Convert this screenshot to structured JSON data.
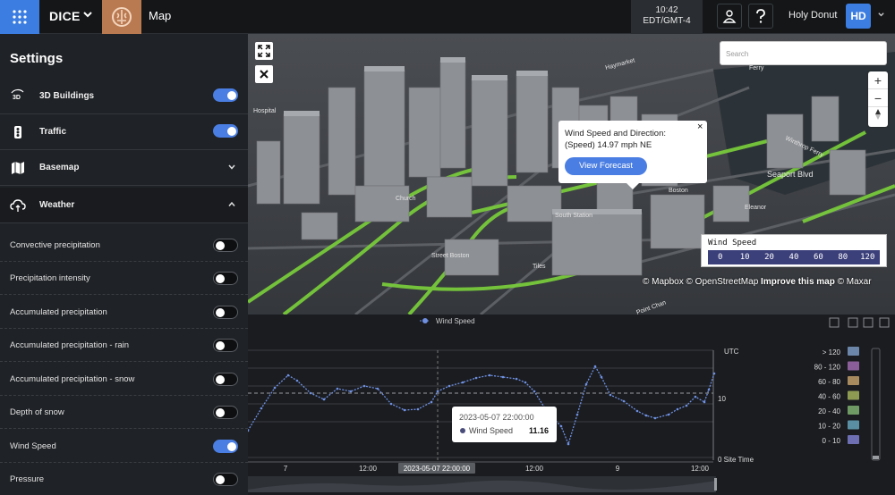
{
  "header": {
    "app_name": "DICE",
    "page_title": "Map",
    "time": "10:42",
    "timezone": "EDT/GMT-4",
    "user_name": "Holy Donut",
    "user_initials": "HD"
  },
  "sidebar": {
    "title": "Settings",
    "sections": [
      {
        "label": "3D Buildings",
        "on": true
      },
      {
        "label": "Traffic",
        "on": true
      },
      {
        "label": "Basemap"
      },
      {
        "label": "Weather"
      }
    ],
    "weather_layers": [
      {
        "label": "Convective precipitation",
        "on": false
      },
      {
        "label": "Precipitation intensity",
        "on": false
      },
      {
        "label": "Accumulated precipitation",
        "on": false
      },
      {
        "label": "Accumulated precipitation - rain",
        "on": false
      },
      {
        "label": "Accumulated precipitation - snow",
        "on": false
      },
      {
        "label": "Depth of snow",
        "on": false
      },
      {
        "label": "Wind Speed",
        "on": true
      },
      {
        "label": "Pressure",
        "on": false
      }
    ]
  },
  "map": {
    "search_placeholder": "Search",
    "popup": {
      "line1": "Wind Speed and Direction:",
      "line2": "(Speed) 14.97 mph NE",
      "button": "View Forecast",
      "close": "×"
    },
    "legend": {
      "title": "Wind Speed",
      "values": [
        "0",
        "10",
        "20",
        "40",
        "60",
        "80",
        "120"
      ]
    },
    "attribution": {
      "mapbox": "© Mapbox",
      "osm": "© OpenStreetMap",
      "improve": "Improve this map",
      "maxar": "© Maxar"
    },
    "labels": [
      "Seaport Blvd",
      "South Station",
      "Winthrop Ferry",
      "Eleanor",
      "Boston",
      "Hospital",
      "Haymarket",
      "Church",
      "Street Boston",
      "Tiles",
      "Ferry",
      "Point Chan"
    ]
  },
  "chart_data": {
    "type": "line",
    "series": [
      {
        "name": "Wind Speed"
      }
    ],
    "legend_position": "top",
    "right_axis_labels": [
      "UTC",
      "10",
      "0 Site Time"
    ],
    "x_ticks": [
      "7",
      "12:00",
      "12:00",
      "9",
      "12:00"
    ],
    "highlight_label": "2023-05-07 22:00:00",
    "tooltip": {
      "time": "2023-05-07 22:00:00",
      "series": "Wind Speed",
      "value": "11.16"
    },
    "color_scale": [
      {
        "label": "> 120",
        "color": "#6b86a8"
      },
      {
        "label": "80 - 120",
        "color": "#8a5f99"
      },
      {
        "label": "60 - 80",
        "color": "#a78a5e"
      },
      {
        "label": "40 - 60",
        "color": "#8c9a52"
      },
      {
        "label": "20 - 40",
        "color": "#6f9a63"
      },
      {
        "label": "10 - 20",
        "color": "#5a8fa3"
      },
      {
        "label": "0 - 10",
        "color": "#6e6fb3"
      }
    ]
  }
}
